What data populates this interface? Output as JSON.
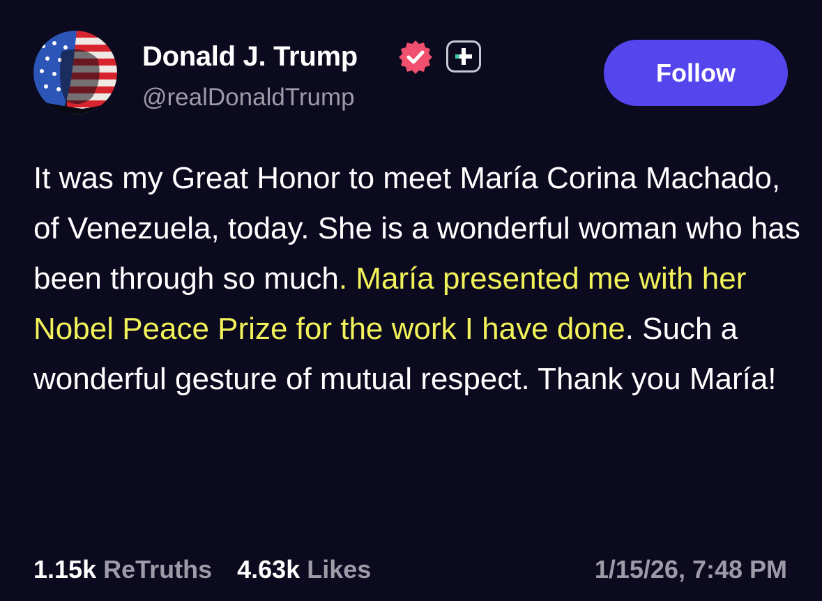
{
  "author": {
    "display_name": "Donald J. Trump",
    "handle": "@realDonaldTrump",
    "avatar_icon": "flag-portrait-avatar",
    "verified_icon": "verified-badge-icon",
    "badge_icon": "plus-badge-icon"
  },
  "actions": {
    "follow_label": "Follow"
  },
  "post": {
    "text_before_highlight": "It was my Great Honor to meet María Corina Machado, of Venezuela, today. She is a wonderful woman who has been through so much",
    "text_highlighted": ". María presented me with her Nobel Peace Prize for the work I have done",
    "text_after_highlight": ". Such a wonderful gesture of mutual respect. Thank you María!"
  },
  "stats": {
    "retruths_count": "1.15k",
    "retruths_label": "ReTruths",
    "likes_count": "4.63k",
    "likes_label": "Likes"
  },
  "timestamp": "1/15/26, 7:48 PM",
  "colors": {
    "background": "#0c0a1f",
    "follow_button": "#5446ec",
    "verified_badge": "#f0506e",
    "highlight_text": "#f2f35a",
    "secondary_text": "#9d9ba8"
  }
}
